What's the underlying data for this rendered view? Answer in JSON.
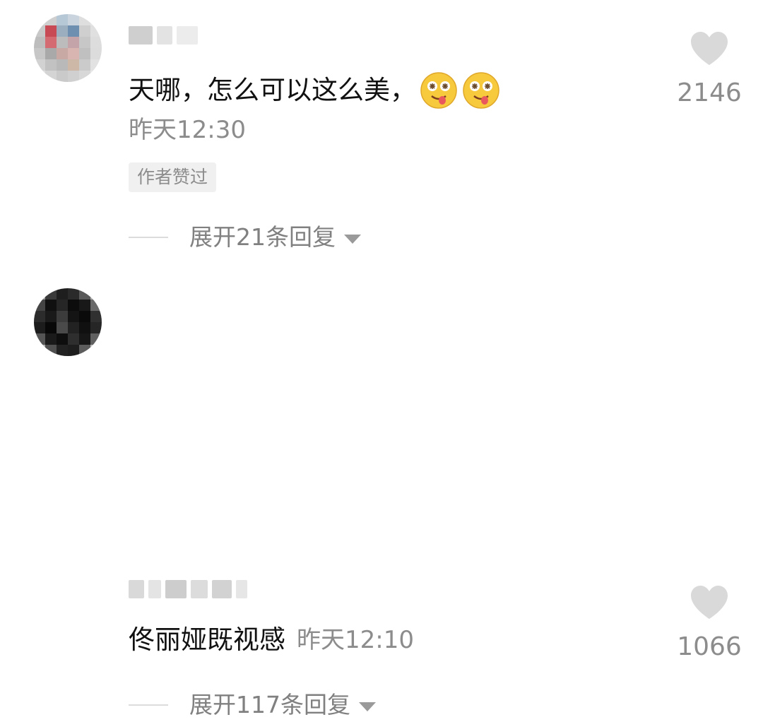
{
  "comments": [
    {
      "text": "天哪，怎么可以这么美，",
      "emojis": [
        "drooling-face-emoji",
        "drooling-face-emoji"
      ],
      "time": "昨天12:30",
      "badge": "作者赞过",
      "replies_label": "展开21条回复",
      "likes": "2146"
    },
    {
      "text": "佟丽娅既视感",
      "time": "昨天12:10",
      "replies_label": "展开117条回复",
      "likes": "1066"
    }
  ],
  "colors": {
    "text": "#111111",
    "muted": "#8c8c8c",
    "heart": "#d9d9d9",
    "badge_bg": "#f0f0f0"
  }
}
